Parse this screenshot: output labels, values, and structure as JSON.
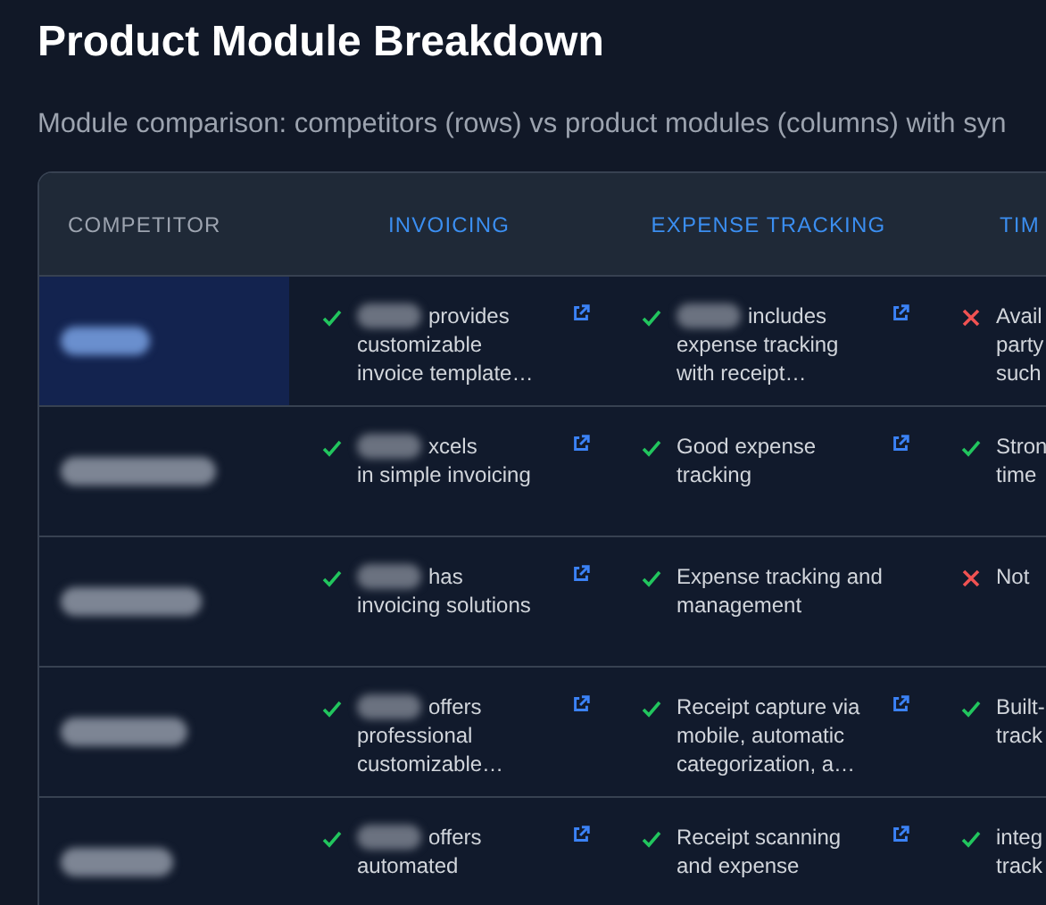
{
  "title": "Product Module Breakdown",
  "subtitle": "Module comparison: competitors (rows) vs product modules (columns) with syn",
  "table": {
    "columns": [
      "COMPETITOR",
      "INVOICING",
      "EXPENSE TRACKING",
      "TIM"
    ],
    "rows": [
      {
        "selected": true,
        "cells": [
          {
            "kind": "blurred"
          },
          {
            "kind": "module",
            "supported": true,
            "redacted": true,
            "link": true,
            "text": "provides\ncustomizable\ninvoice template…"
          },
          {
            "kind": "module",
            "supported": true,
            "redacted": true,
            "link": true,
            "text": "includes\nexpense tracking\nwith receipt…"
          },
          {
            "kind": "module",
            "supported": false,
            "redacted": false,
            "link": false,
            "text": "Avail\nparty\nsuch"
          }
        ]
      },
      {
        "selected": false,
        "cells": [
          {
            "kind": "blurred"
          },
          {
            "kind": "module",
            "supported": true,
            "redacted": true,
            "link": true,
            "text": "xcels\nin simple invoicing"
          },
          {
            "kind": "module",
            "supported": true,
            "redacted": false,
            "link": true,
            "text": "Good expense\ntracking"
          },
          {
            "kind": "module",
            "supported": true,
            "redacted": false,
            "link": false,
            "text": "Stron\ntime"
          }
        ]
      },
      {
        "selected": false,
        "cells": [
          {
            "kind": "blurred"
          },
          {
            "kind": "module",
            "supported": true,
            "redacted": true,
            "link": true,
            "text": "has\ninvoicing solutions"
          },
          {
            "kind": "module",
            "supported": true,
            "redacted": false,
            "link": false,
            "text": "Expense tracking and\nmanagement"
          },
          {
            "kind": "module",
            "supported": false,
            "redacted": false,
            "link": false,
            "text": "Not"
          }
        ]
      },
      {
        "selected": false,
        "cells": [
          {
            "kind": "blurred"
          },
          {
            "kind": "module",
            "supported": true,
            "redacted": true,
            "link": true,
            "text": "offers\nprofessional\ncustomizable…"
          },
          {
            "kind": "module",
            "supported": true,
            "redacted": false,
            "link": true,
            "text": "Receipt capture via\nmobile, automatic\ncategorization, a…"
          },
          {
            "kind": "module",
            "supported": true,
            "redacted": false,
            "link": false,
            "text": "Built-\ntrack"
          }
        ]
      },
      {
        "selected": false,
        "cells": [
          {
            "kind": "blurred"
          },
          {
            "kind": "module",
            "supported": true,
            "redacted": true,
            "link": true,
            "text": "offers\nautomated"
          },
          {
            "kind": "module",
            "supported": true,
            "redacted": false,
            "link": true,
            "text": "Receipt scanning\nand expense"
          },
          {
            "kind": "module",
            "supported": true,
            "redacted": false,
            "link": false,
            "text": "integ\ntrack"
          }
        ]
      }
    ]
  }
}
